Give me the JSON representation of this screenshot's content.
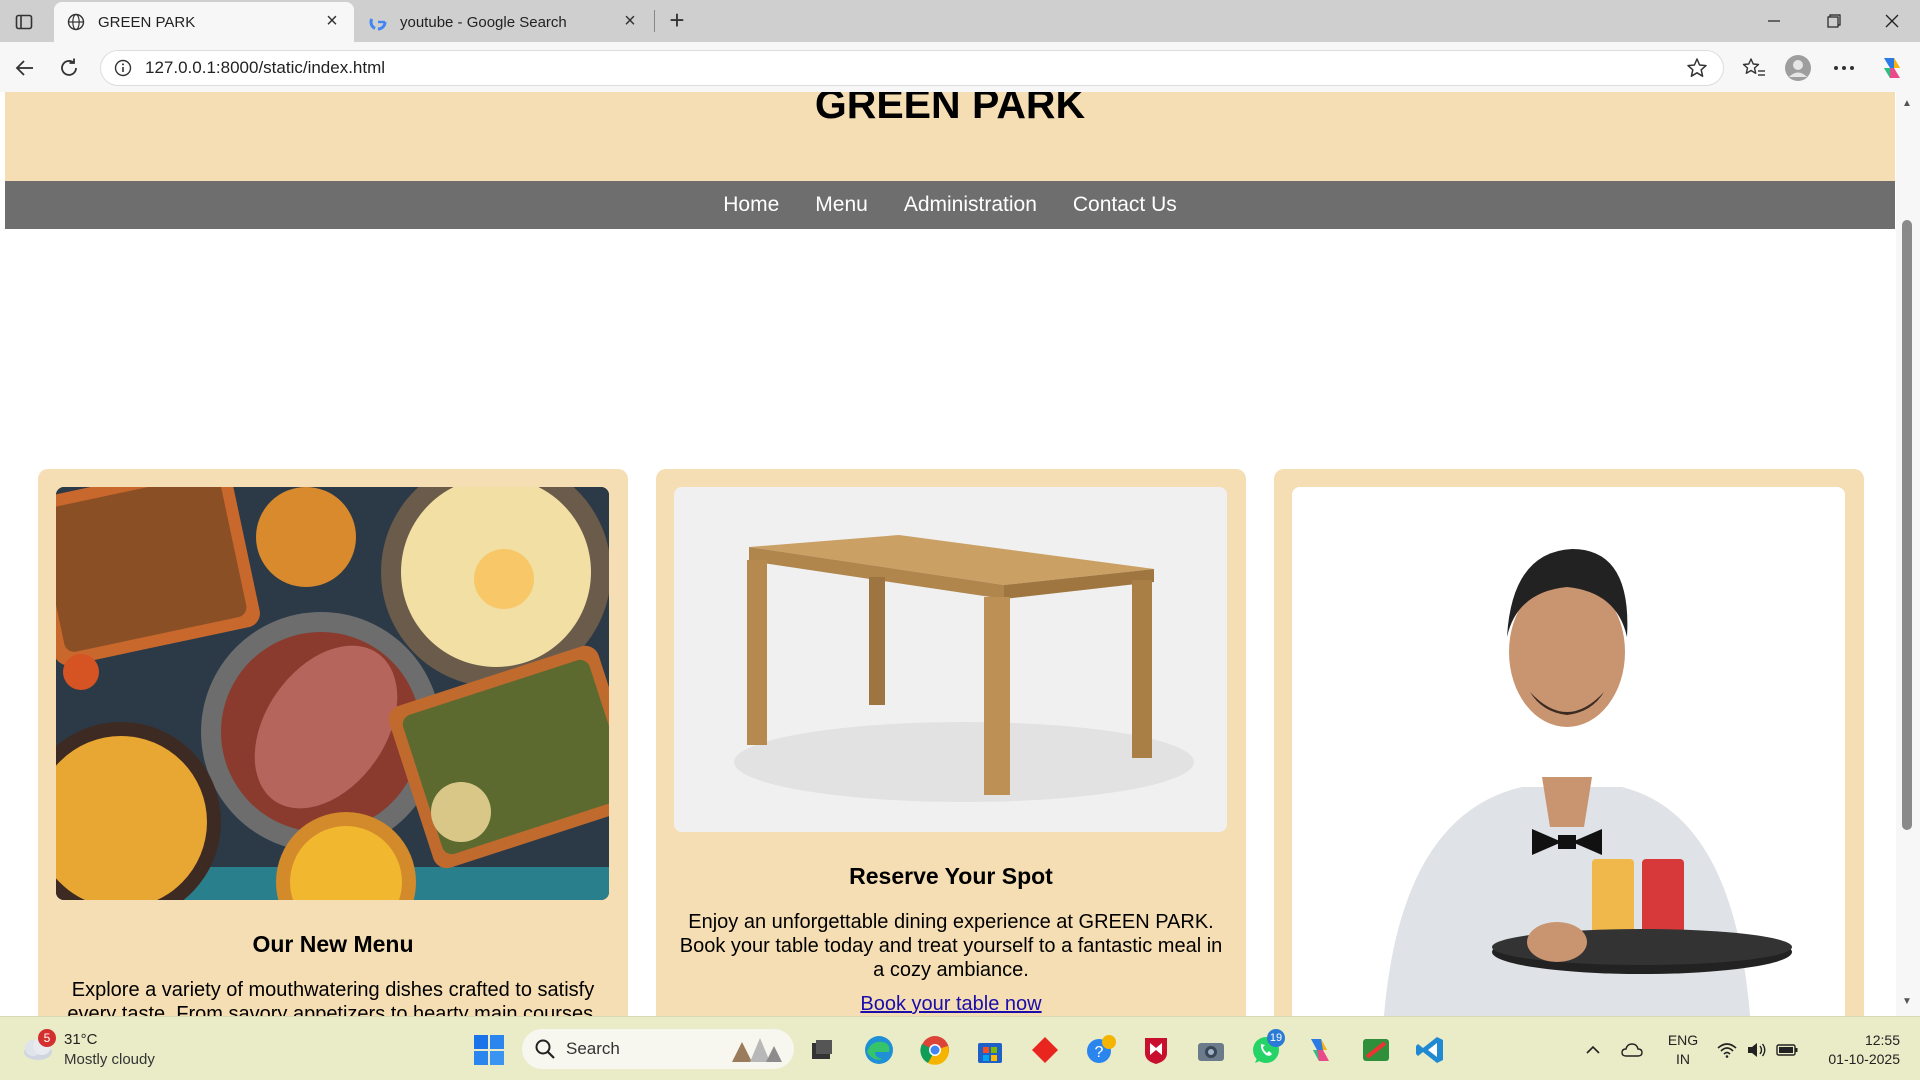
{
  "browser": {
    "tabs": [
      {
        "title": "GREEN PARK",
        "active": true
      },
      {
        "title": "youtube - Google Search",
        "active": false
      }
    ],
    "url": "127.0.0.1:8000/static/index.html"
  },
  "site": {
    "title": "GREEN PARK",
    "nav": [
      "Home",
      "Menu",
      "Administration",
      "Contact Us"
    ],
    "cards": [
      {
        "heading": "Our New Menu",
        "text": "Explore a variety of mouthwatering dishes crafted to satisfy every taste. From savory appetizers to hearty main courses."
      },
      {
        "heading": "Reserve Your Spot",
        "text": "Enjoy an unforgettable dining experience at GREEN PARK. Book your table today and treat yourself to a fantastic meal in a cozy ambiance.",
        "link": "Book your table now"
      },
      {
        "heading": "",
        "text": ""
      }
    ]
  },
  "taskbar": {
    "weather": {
      "badge": "5",
      "temp": "31°C",
      "condition": "Mostly cloudy"
    },
    "search_placeholder": "Search",
    "whatsapp_badge": "19",
    "lang": {
      "line1": "ENG",
      "line2": "IN"
    },
    "clock": {
      "time": "12:55",
      "date": "01-10-2025"
    }
  },
  "colors": {
    "header_bg": "#f5deb3",
    "nav_bg": "#6e6e6e",
    "card_bg": "#f5deb3",
    "link": "#1a0dab",
    "taskbar_bg": "#e9ecc7"
  }
}
